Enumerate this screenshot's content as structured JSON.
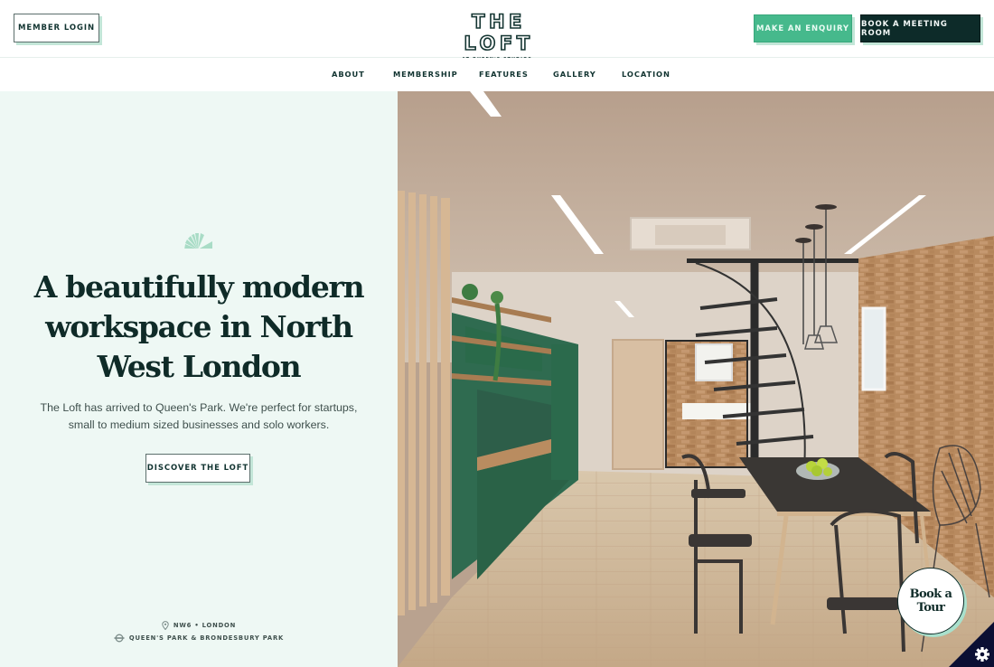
{
  "header": {
    "member_login": "MEMBER LOGIN",
    "logo_title": "THE LOFT",
    "logo_subtitle": "AT QUEEN'S STUDIOS",
    "enquiry_button": "MAKE AN ENQUIRY",
    "meeting_button": "BOOK A MEETING ROOM"
  },
  "nav": {
    "items": [
      {
        "label": "ABOUT"
      },
      {
        "label": "MEMBERSHIP"
      },
      {
        "label": "FEATURES"
      },
      {
        "label": "GALLERY"
      },
      {
        "label": "LOCATION"
      }
    ]
  },
  "hero": {
    "icon": "fan-sunburst-icon",
    "headline": "A beautifully modern workspace in North West London",
    "intro": "The Loft has arrived to Queen's Park. We're perfect for startups, small to medium sized businesses and solo workers.",
    "cta": "DISCOVER THE LOFT",
    "location": {
      "area": "NW6 • LONDON",
      "area_icon": "map-pin-icon",
      "stations": "QUEEN'S PARK & BRONDESBURY PARK",
      "stations_icon": "underground-roundel-icon"
    },
    "image_description": "Interior rendering of modern loft workspace with green kitchen, spiral staircase, brick wall and dining table"
  },
  "floating": {
    "tour_button": "Book a Tour",
    "cookie_icon": "gear-icon"
  },
  "colors": {
    "accent_green": "#46b98c",
    "dark_green": "#0d2b29",
    "mint_bg": "#eef8f4",
    "shadow_mint": "#c3e6d8",
    "cookie_navy": "#0b0f33"
  }
}
